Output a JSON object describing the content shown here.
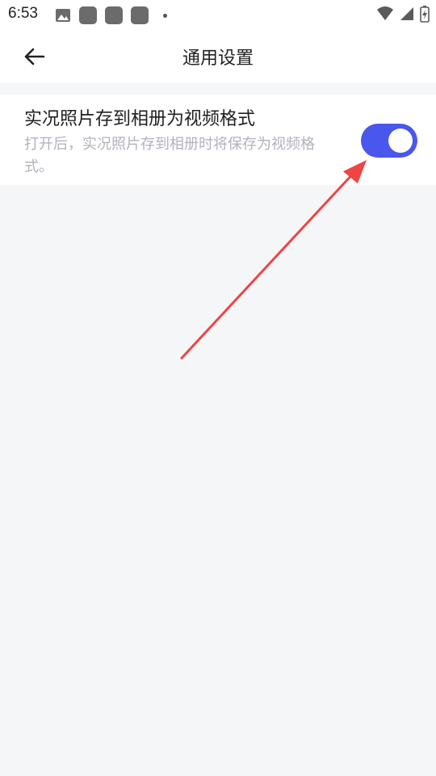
{
  "status_bar": {
    "time": "6:53"
  },
  "header": {
    "title": "通用设置"
  },
  "setting": {
    "title": "实况照片存到相册为视频格式",
    "description": "打开后，实况照片存到相册时将保存为视频格式。",
    "toggle_on": true
  },
  "colors": {
    "accent": "#4957ec",
    "background": "#f5f6f8",
    "annotation": "#ee4444"
  }
}
